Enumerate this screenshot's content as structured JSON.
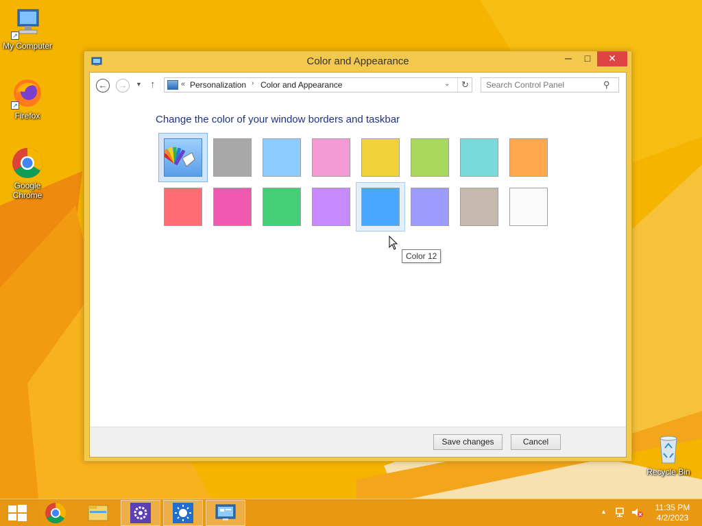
{
  "desktop": {
    "icons": [
      {
        "label": "My Computer"
      },
      {
        "label": "Firefox"
      },
      {
        "label": "Google\nChrome"
      },
      {
        "label": "Recycle Bin"
      }
    ]
  },
  "window": {
    "title": "Color and Appearance",
    "controls": {
      "minimize": "─",
      "maximize": "□",
      "close": "✕"
    },
    "nav": {
      "back": "←",
      "forward": "→",
      "recent": "▼",
      "up": "↑",
      "breadcrumb_overflow": "«",
      "breadcrumbs": [
        "Personalization",
        "Color and Appearance"
      ],
      "separator": "›",
      "dropdown": "⌄",
      "refresh": "↻"
    },
    "search": {
      "placeholder": "Search Control Panel"
    },
    "heading": "Change the color of your window borders and taskbar",
    "swatches": [
      {
        "color": "auto",
        "state": "selected"
      },
      {
        "color": "#a8a8a8"
      },
      {
        "color": "#8ecbff"
      },
      {
        "color": "#f39ad4"
      },
      {
        "color": "#f1d23c"
      },
      {
        "color": "#a9d95c"
      },
      {
        "color": "#7ad9d9"
      },
      {
        "color": "#ffa84d"
      },
      {
        "color": "#ff6b73"
      },
      {
        "color": "#f058b0"
      },
      {
        "color": "#45cf79"
      },
      {
        "color": "#c78bff"
      },
      {
        "color": "#4aa7ff",
        "state": "hover"
      },
      {
        "color": "#9c9cff"
      },
      {
        "color": "#c5b8ad"
      },
      {
        "color": "#fbfbfb"
      }
    ],
    "tooltip": "Color 12",
    "buttons": {
      "save": "Save changes",
      "cancel": "Cancel"
    }
  },
  "taskbar": {
    "items": [
      "start-icon",
      "chrome-icon",
      "file-explorer-icon",
      "settings-icon",
      "brightness-icon",
      "personalization-icon"
    ],
    "tray": {
      "time": "11:35 PM",
      "date": "4/2/2023"
    }
  }
}
